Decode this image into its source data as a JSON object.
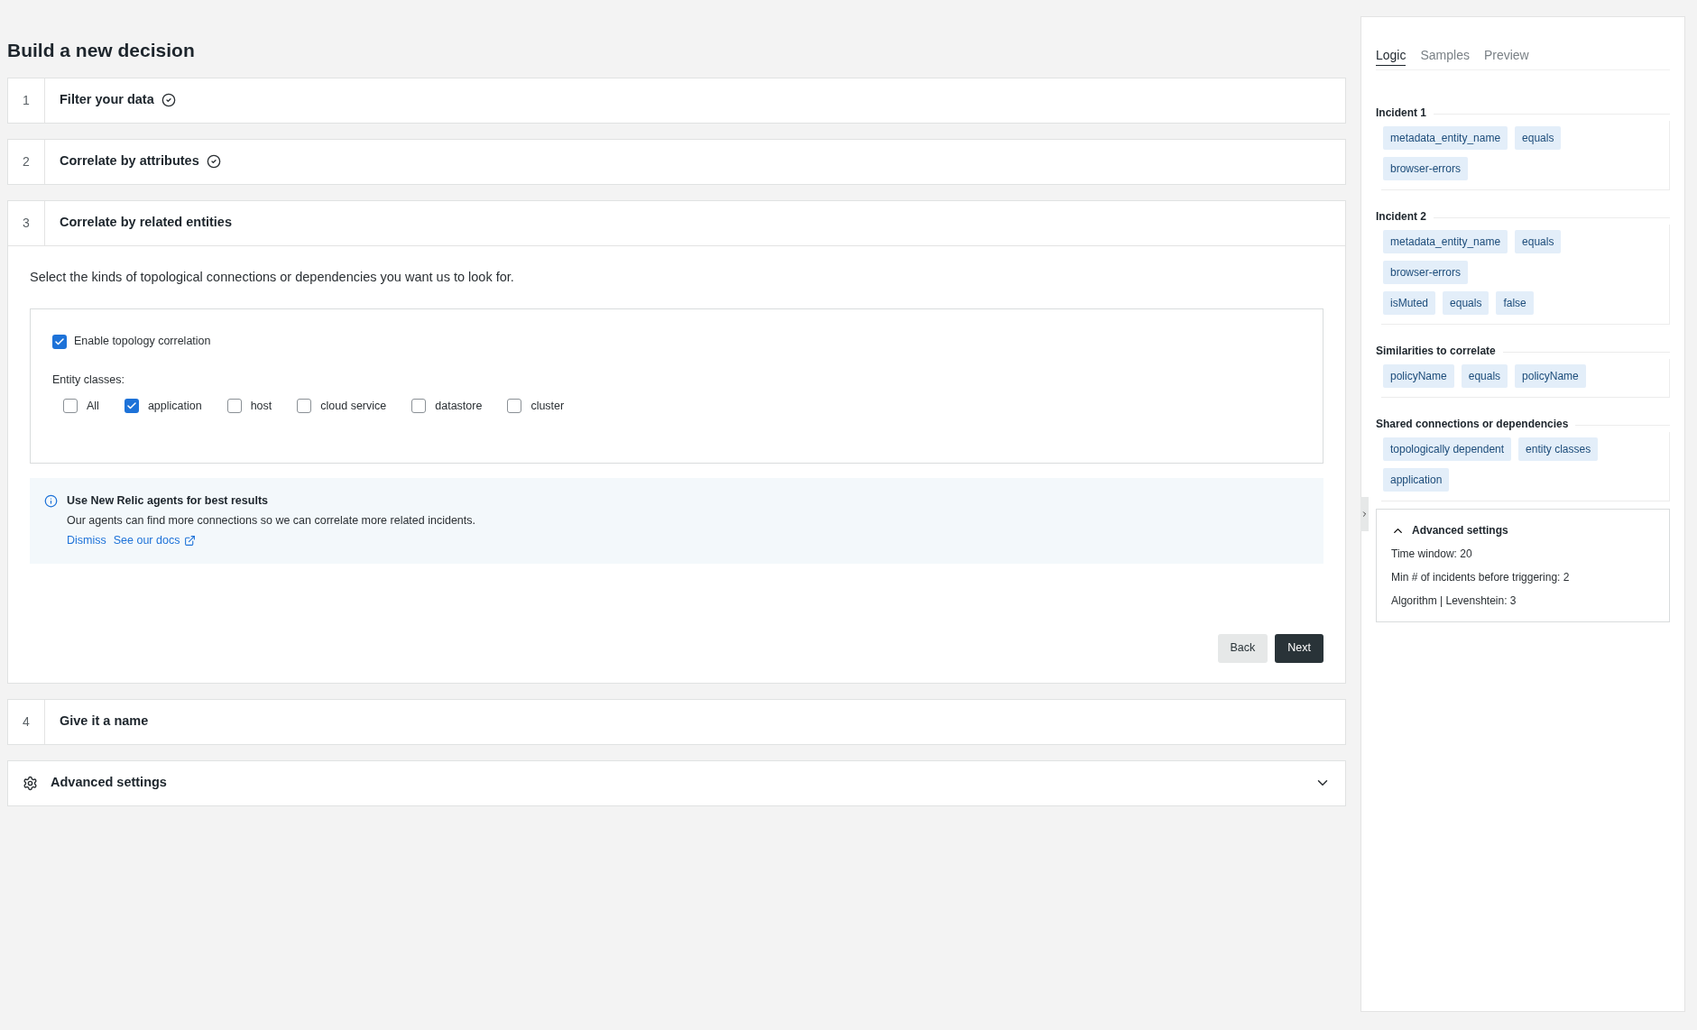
{
  "page_title": "Build a new decision",
  "steps": [
    {
      "number": "1",
      "title": "Filter your data",
      "completed": true,
      "expanded": false
    },
    {
      "number": "2",
      "title": "Correlate by attributes",
      "completed": true,
      "expanded": false
    },
    {
      "number": "3",
      "title": "Correlate by related entities",
      "completed": false,
      "expanded": true,
      "body": {
        "description": "Select the kinds of topological connections or dependencies you want us to look for.",
        "enable": {
          "label": "Enable topology correlation",
          "checked": true
        },
        "entity_label": "Entity classes:",
        "entity_classes": [
          {
            "label": "All",
            "checked": false
          },
          {
            "label": "application",
            "checked": true
          },
          {
            "label": "host",
            "checked": false
          },
          {
            "label": "cloud service",
            "checked": false
          },
          {
            "label": "datastore",
            "checked": false
          },
          {
            "label": "cluster",
            "checked": false
          }
        ],
        "info": {
          "title": "Use New Relic agents for best results",
          "text": "Our agents can find more connections so we can correlate more related incidents.",
          "links": [
            {
              "label": "Dismiss",
              "external": false
            },
            {
              "label": "See our docs",
              "external": true
            }
          ]
        },
        "buttons": [
          {
            "label": "Back",
            "kind": "secondary"
          },
          {
            "label": "Next",
            "kind": "primary"
          }
        ]
      }
    },
    {
      "number": "4",
      "title": "Give it a name",
      "completed": false,
      "expanded": false
    }
  ],
  "advanced_settings": {
    "title": "Advanced settings",
    "expanded": false
  },
  "panel": {
    "tabs": [
      {
        "label": "Logic",
        "selected": true
      },
      {
        "label": "Samples",
        "selected": false
      },
      {
        "label": "Preview",
        "selected": false
      }
    ],
    "sections": [
      {
        "title": "Incident 1",
        "tag_rows": [
          [
            "metadata_entity_name",
            "equals"
          ],
          [
            "browser-errors"
          ]
        ]
      },
      {
        "title": "Incident 2",
        "tag_rows": [
          [
            "metadata_entity_name",
            "equals"
          ],
          [
            "browser-errors"
          ],
          [
            "isMuted",
            "equals",
            "false"
          ]
        ]
      },
      {
        "title": "Similarities to correlate",
        "tag_rows": [
          [
            "policyName",
            "equals",
            "policyName"
          ]
        ]
      },
      {
        "title": "Shared connections or dependencies",
        "tag_rows": [
          [
            "topologically dependent",
            "entity classes"
          ],
          [
            "application"
          ]
        ]
      }
    ],
    "advanced": {
      "title": "Advanced settings",
      "expanded": true,
      "lines": [
        "Time window: 20",
        "Min # of incidents before triggering: 2",
        "Algorithm | Levenshtein: 3"
      ]
    }
  }
}
